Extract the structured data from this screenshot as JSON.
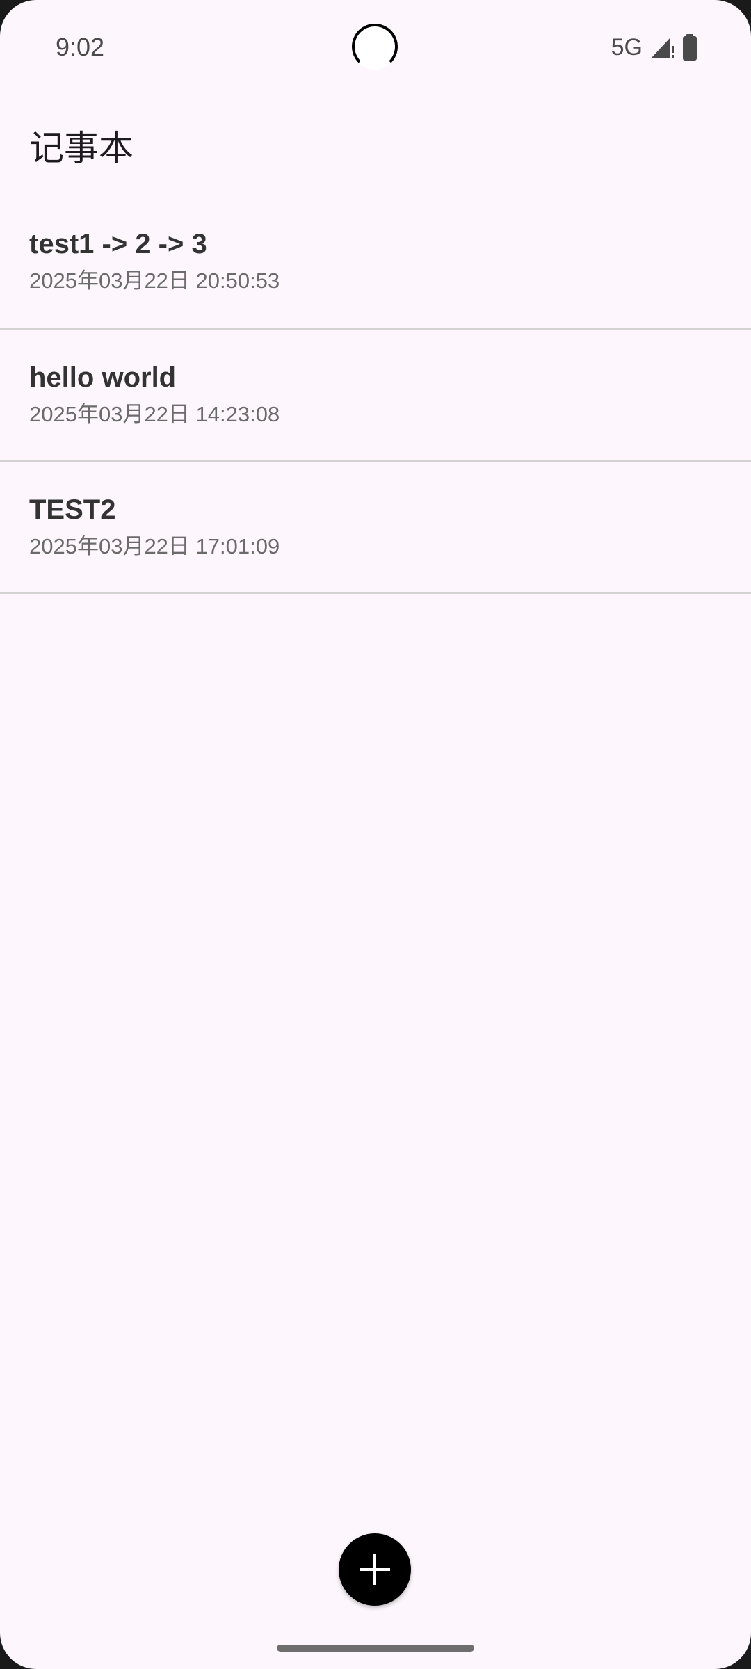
{
  "status_bar": {
    "time": "9:02",
    "network": "5G",
    "icons": [
      "camera-cutout",
      "signal-icon",
      "battery-icon"
    ]
  },
  "app": {
    "title": "记事本"
  },
  "notes": [
    {
      "title": "test1 -> 2 -> 3",
      "date": "2025年03月22日 20:50:53"
    },
    {
      "title": "hello world",
      "date": "2025年03月22日 14:23:08"
    },
    {
      "title": "TEST2",
      "date": "2025年03月22日 17:01:09"
    }
  ],
  "fab": {
    "icon": "plus-icon"
  },
  "colors": {
    "background": "#fdf7fd",
    "divider": "#d3d3d3",
    "fab": "#000000",
    "title_text": "#333333",
    "date_text": "#6b6b6b"
  }
}
